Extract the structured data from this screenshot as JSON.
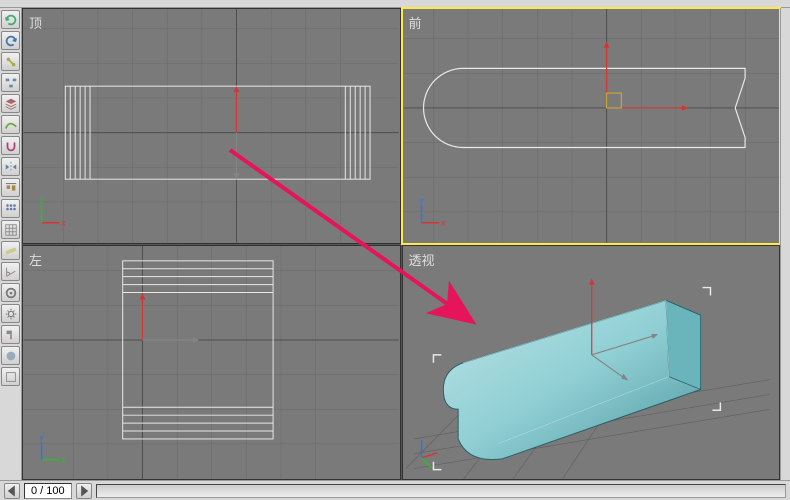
{
  "viewports": {
    "top": "顶",
    "front": "前",
    "left": "左",
    "perspective": "透视"
  },
  "timeline": {
    "frame_display": "0 / 100"
  },
  "colors": {
    "grid": "#6a6a6a",
    "grid_dark": "#4d4d4d",
    "wireframe": "#e8e8e8",
    "gizmo_x": "#d43636",
    "gizmo_y": "#2dbb2d",
    "gizmo_z": "#3a6fe0",
    "active_border": "#ffe84a",
    "shaded_fill": "#8fcfd4",
    "shaded_dark": "#5aa6ae",
    "annotation": "#e6145a"
  },
  "tools": [
    "undo-icon",
    "redo-icon",
    "link-icon",
    "schematic-icon",
    "layers-icon",
    "curve-icon",
    "snap-icon",
    "mirror-icon",
    "align-icon",
    "array-icon",
    "grid-icon",
    "measure-icon",
    "angle-icon",
    "manage-icon",
    "settings-icon",
    "hammer-icon",
    "misc-icon",
    "last-icon"
  ]
}
